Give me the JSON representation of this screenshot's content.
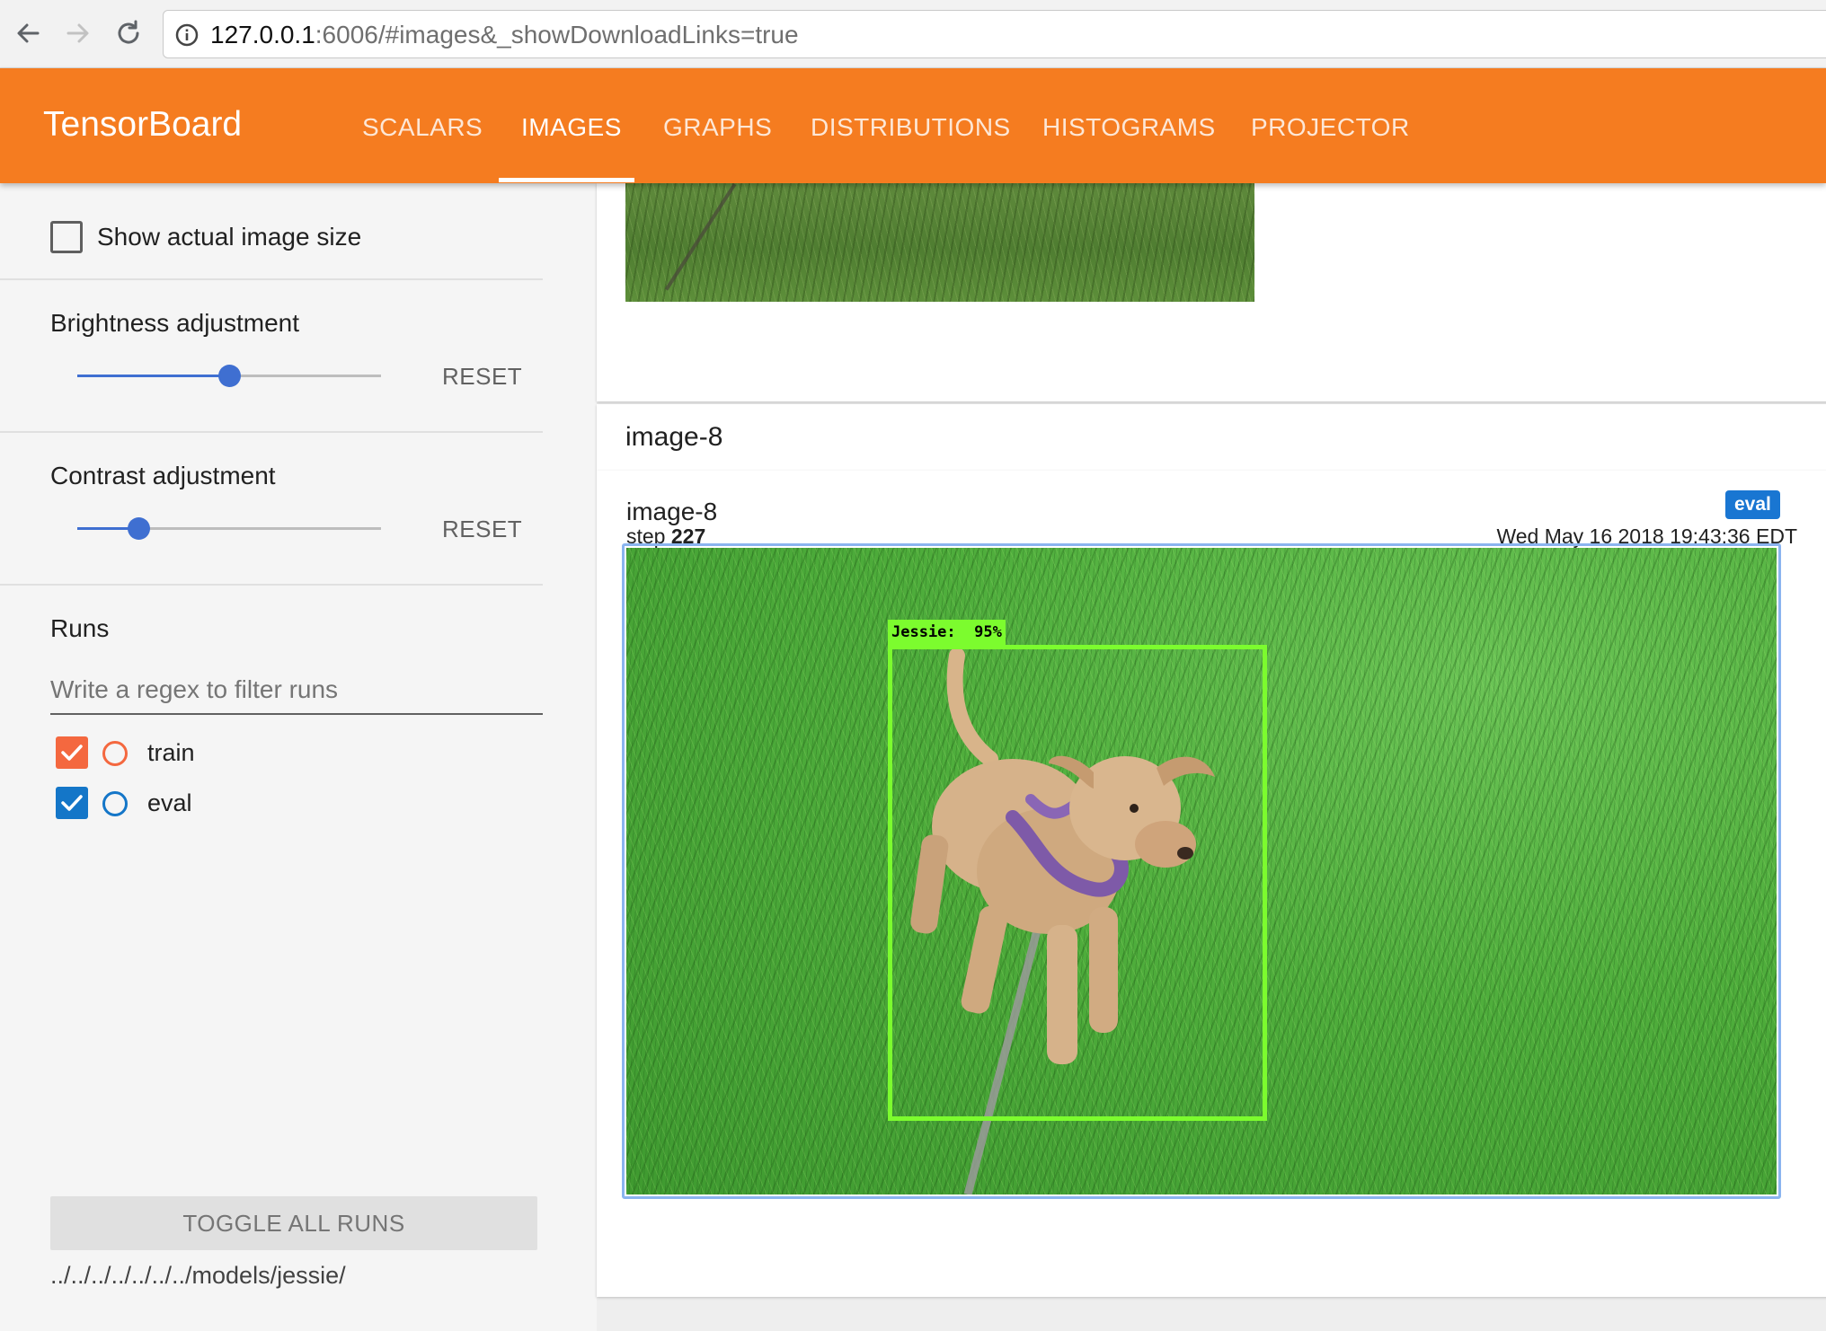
{
  "browser": {
    "url_host": "127.0.0.1",
    "url_rest": ":6006/#images&_showDownloadLinks=true"
  },
  "header": {
    "title": "TensorBoard",
    "tabs": [
      {
        "label": "SCALARS"
      },
      {
        "label": "IMAGES",
        "active": true
      },
      {
        "label": "GRAPHS"
      },
      {
        "label": "DISTRIBUTIONS"
      },
      {
        "label": "HISTOGRAMS"
      },
      {
        "label": "PROJECTOR"
      }
    ]
  },
  "sidebar": {
    "show_actual_size_label": "Show actual image size",
    "show_actual_size_checked": false,
    "brightness": {
      "label": "Brightness adjustment",
      "reset": "RESET",
      "value": 0.5
    },
    "contrast": {
      "label": "Contrast adjustment",
      "reset": "RESET",
      "value": 0.2
    },
    "runs_title": "Runs",
    "filter_placeholder": "Write a regex to filter runs",
    "runs": [
      {
        "name": "train",
        "checked": true,
        "color": "#f4683f"
      },
      {
        "name": "eval",
        "checked": true,
        "color": "#1476c8"
      }
    ],
    "toggle_all_label": "TOGGLE ALL RUNS",
    "logdir": "../../../../../../../models/jessie/"
  },
  "main": {
    "section_title": "image-8",
    "card": {
      "title": "image-8",
      "step_label": "step",
      "step_value": "227",
      "run_badge": "eval",
      "timestamp": "Wed May 16 2018 19:43:36 EDT",
      "detection_label": "Jessie:  95%"
    }
  },
  "colors": {
    "header_orange": "#f57c20",
    "slider_blue": "#3f6fd1",
    "bbox_green": "#7cfc2e",
    "badge_blue": "#1976d2"
  },
  "icons": [
    "back-arrow-icon",
    "forward-arrow-icon",
    "reload-icon",
    "info-icon",
    "checkmark-icon"
  ]
}
